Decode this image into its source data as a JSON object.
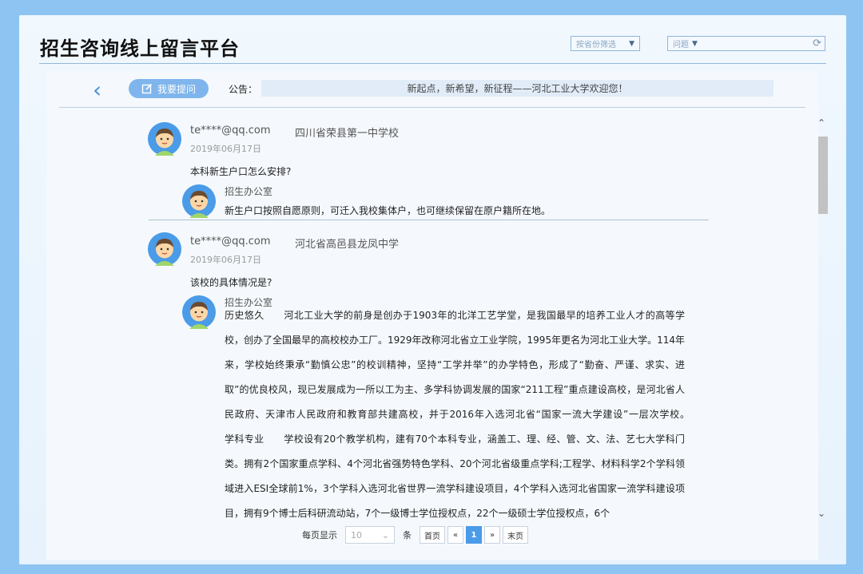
{
  "site_title": "招生咨询线上留言平台",
  "filters": {
    "province_placeholder": "按省份筛选",
    "question_placeholder": "问题"
  },
  "toolbar": {
    "ask_label": "我要提问",
    "notice_label": "公告：",
    "notice_text": "新起点，新希望，新征程——河北工业大学欢迎您！"
  },
  "messages": [
    {
      "user": "te****@qq.com",
      "school": "四川省荣县第一中学校",
      "date": "2019年06月17日",
      "question": "本科新生户口怎么安排?",
      "reply_author": "招生办公室",
      "reply": "新生户口按照自愿原则，可迁入我校集体户，也可继续保留在原户籍所在地。"
    },
    {
      "user": "te****@qq.com",
      "school": "河北省高邑县龙凤中学",
      "date": "2019年06月17日",
      "question": "该校的具体情况是?",
      "reply_author": "招生办公室",
      "reply": "历史悠久　　河北工业大学的前身是创办于1903年的北洋工艺学堂，是我国最早的培养工业人才的高等学校，创办了全国最早的高校校办工厂。1929年改称河北省立工业学院，1995年更名为河北工业大学。114年来，学校始终秉承“勤慎公忠”的校训精神，坚持“工学并举”的办学特色，形成了“勤奋、严谨、求实、进取”的优良校风，现已发展成为一所以工为主、多学科协调发展的国家“211工程”重点建设高校，是河北省人民政府、天津市人民政府和教育部共建高校，并于2016年入选河北省“国家一流大学建设”一层次学校。　　学科专业　　学校设有20个教学机构，建有70个本科专业，涵盖工、理、经、管、文、法、艺七大学科门类。拥有2个国家重点学科、4个河北省强势特色学科、20个河北省级重点学科;工程学、材料科学2个学科领域进入ESI全球前1%，3个学科入选河北省世界一流学科建设项目，4个学科入选河北省国家一流学科建设项目，拥有9个博士后科研流动站，7个一级博士学位授权点，22个一级硕士学位授权点，6个"
    }
  ],
  "pager": {
    "per_page_label": "每页显示",
    "per_page_value": "10",
    "unit_label": "条",
    "first_label": "首页",
    "prev_label": "«",
    "current_page": "1",
    "next_label": "»",
    "last_label": "末页"
  },
  "colors": {
    "accent": "#4a9be8",
    "button": "#7fb5ec",
    "background": "#8ec4f2"
  },
  "icons": {
    "back": "chevron-left-icon",
    "ask": "edit-icon",
    "refresh": "refresh-icon",
    "avatar": "user-avatar-icon"
  }
}
